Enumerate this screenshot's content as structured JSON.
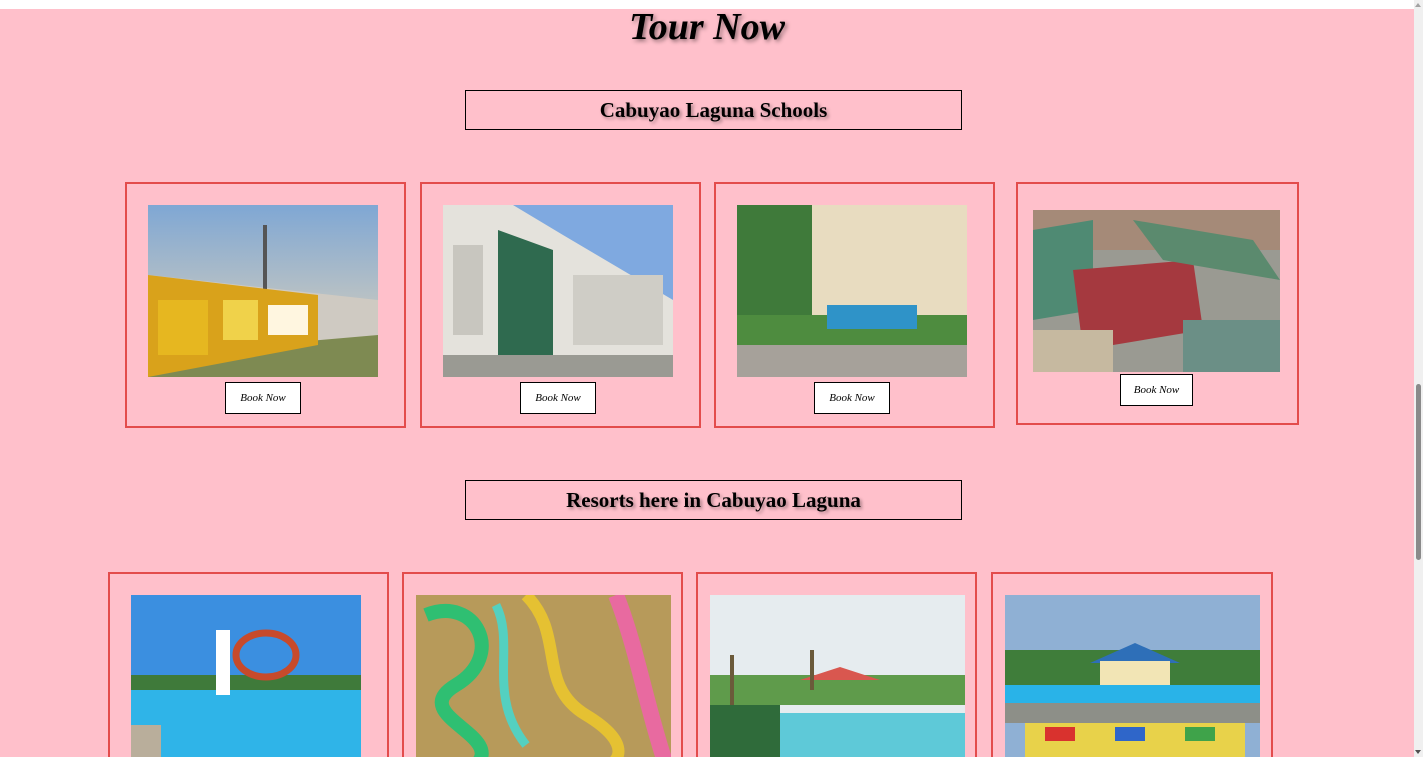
{
  "page": {
    "title": "Tour Now"
  },
  "sections": [
    {
      "heading": "Cabuyao Laguna Schools",
      "cards": [
        {
          "image": "school-citech-photo",
          "button": "Book Now"
        },
        {
          "image": "school-building-photo",
          "button": "Book Now"
        },
        {
          "image": "school-sinhs-photo",
          "button": "Book Now"
        },
        {
          "image": "school-southville-aerial-photo",
          "button": "Book Now"
        }
      ]
    },
    {
      "heading": "Resorts here in Cabuyao Laguna",
      "cards": [
        {
          "image": "resort-waterslide-pool-photo"
        },
        {
          "image": "resort-slides-aerial-photo"
        },
        {
          "image": "resort-palm-pool-photo"
        },
        {
          "image": "resort-pool-clubhouse-photo"
        }
      ]
    }
  ],
  "colors": {
    "background": "#ffc0cb",
    "card_border": "#e34c4c"
  }
}
